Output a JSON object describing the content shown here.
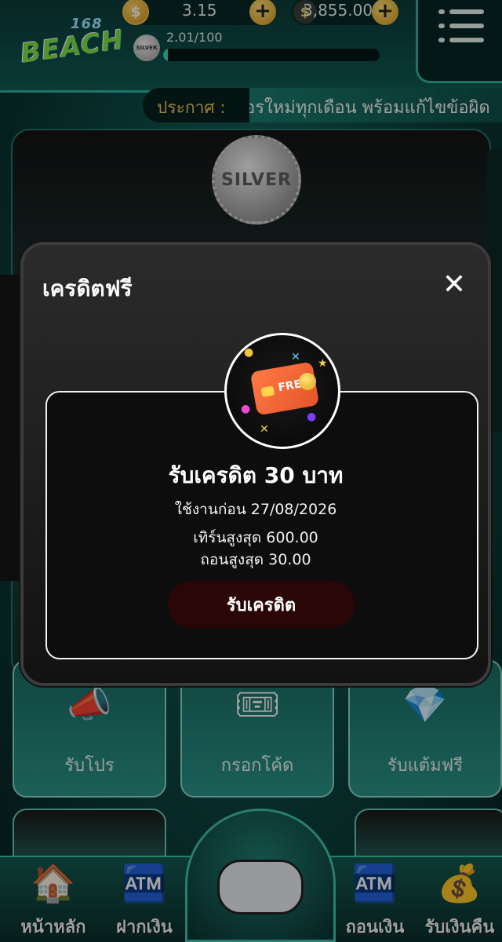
{
  "header": {
    "logo_text": "BEACH",
    "logo_number": "168",
    "coin_balance": "3.15",
    "money_balance": "3,855.00",
    "money_symbol": "$",
    "coin_symbol": "$",
    "tier_badge": "SILVER",
    "progress_text": "2.01/100",
    "progress_fraction": 0.0201
  },
  "announcement": {
    "label": "ประกาศ :",
    "text": "อรใหม่ทุกเดือน พร้อมแก้ไขข้อผิด"
  },
  "rank_medal": "SILVER",
  "tiles": [
    {
      "label": "รับโปร"
    },
    {
      "label": "กรอกโค้ด"
    },
    {
      "label": "รับแต้มฟรี"
    }
  ],
  "bottom_nav": [
    {
      "label": "หน้าหลัก",
      "icon": "house-icon"
    },
    {
      "label": "ฝากเงิน",
      "icon": "deposit-icon"
    },
    {
      "label": "ถอนเงิน",
      "icon": "withdraw-icon"
    },
    {
      "label": "รับเงินคืน",
      "icon": "cashback-icon"
    }
  ],
  "modal": {
    "title": "เครดิตฟรี",
    "close_symbol": "✕",
    "emblem_text": "FREE",
    "heading": "รับเครดิต 30 บาท",
    "expire": "ใช้งานก่อน 27/08/2026",
    "turnover": "เทิร์นสูงสุด 600.00",
    "withdraw_max": "ถอนสูงสุด 30.00",
    "claim_label": "รับเครดิต"
  },
  "colors": {
    "accent_teal": "#2fb3a2",
    "gold": "#f2c15c",
    "claim_button": "#2a0606"
  }
}
